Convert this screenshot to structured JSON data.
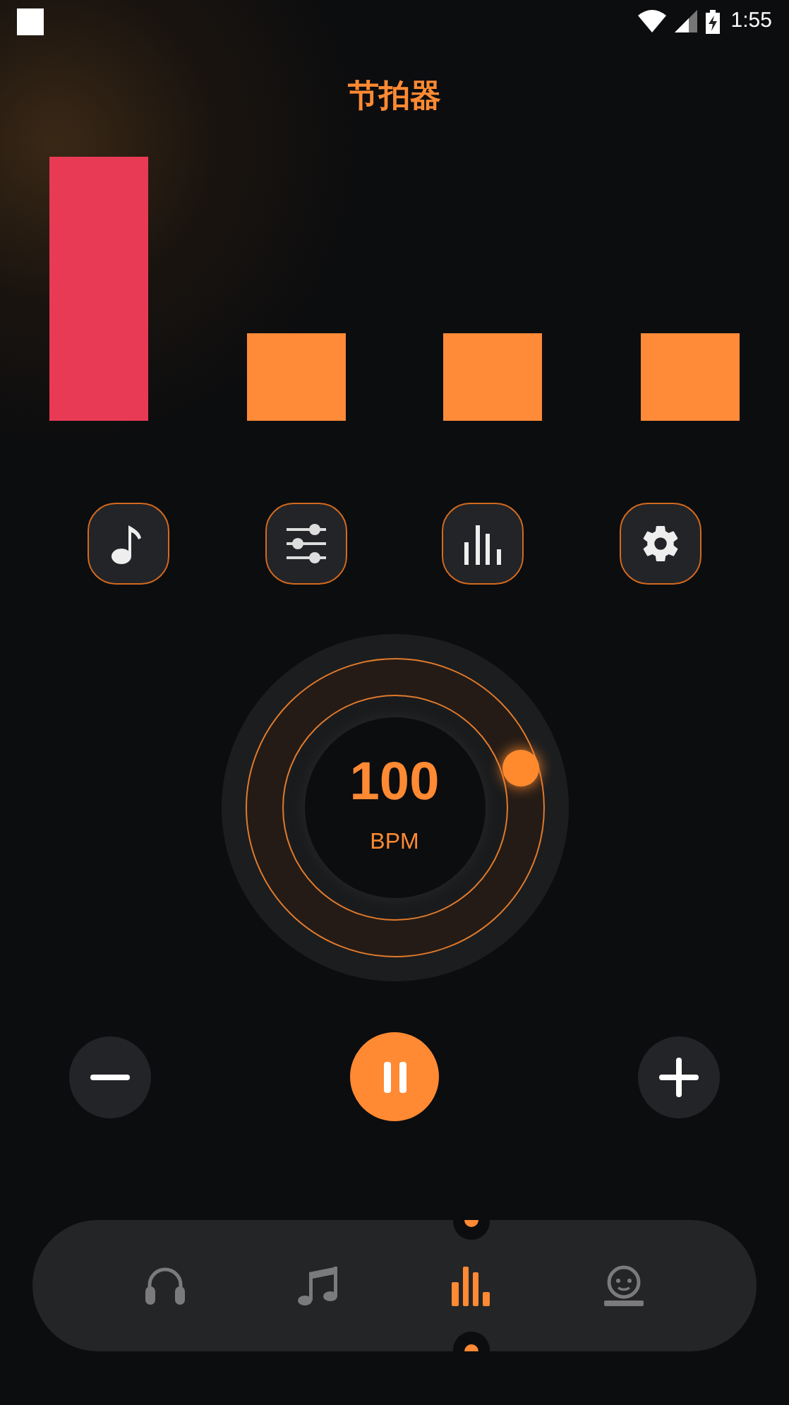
{
  "status_bar": {
    "time": "1:55"
  },
  "title": "节拍器",
  "beats": [
    {
      "selected": true
    },
    {
      "selected": false
    },
    {
      "selected": false
    },
    {
      "selected": false
    }
  ],
  "tools": [
    {
      "kind": "note"
    },
    {
      "kind": "sliders"
    },
    {
      "kind": "bars"
    },
    {
      "kind": "gear"
    }
  ],
  "tempo": {
    "value": "100",
    "unit": "BPM"
  },
  "controls": {
    "playing": true
  },
  "nav": [
    {
      "kind": "headphones",
      "selected": false
    },
    {
      "kind": "music",
      "selected": false
    },
    {
      "kind": "bars",
      "selected": true
    },
    {
      "kind": "face",
      "selected": false
    }
  ]
}
